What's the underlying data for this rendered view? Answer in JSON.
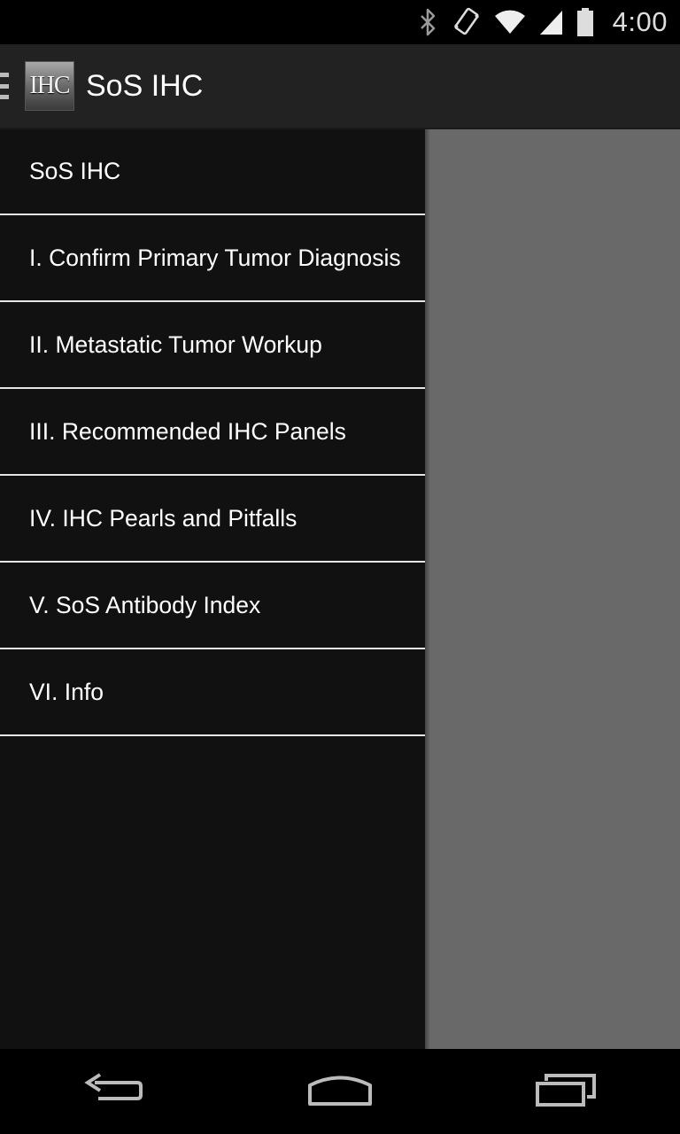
{
  "status_bar": {
    "time": "4:00",
    "icons": [
      "bluetooth-icon",
      "vibrate-icon",
      "wifi-icon",
      "signal-icon",
      "battery-icon"
    ]
  },
  "action_bar": {
    "logo_text": "IHC",
    "title": "SoS IHC"
  },
  "drawer": {
    "items": [
      {
        "label": "SoS IHC"
      },
      {
        "label": "I. Confirm Primary Tumor Diagnosis"
      },
      {
        "label": "II. Metastatic Tumor Workup"
      },
      {
        "label": "III. Recommended IHC Panels"
      },
      {
        "label": "IV. IHC Pearls and Pitfalls"
      },
      {
        "label": "V. SoS Antibody Index"
      },
      {
        "label": "VI. Info"
      }
    ]
  },
  "nav_bar": {
    "buttons": [
      "back-icon",
      "home-icon",
      "recents-icon"
    ]
  },
  "colors": {
    "action_bar_bg": "#222222",
    "drawer_bg": "#111111",
    "dim_overlay": "#696969",
    "divider": "#e6e6e6"
  }
}
